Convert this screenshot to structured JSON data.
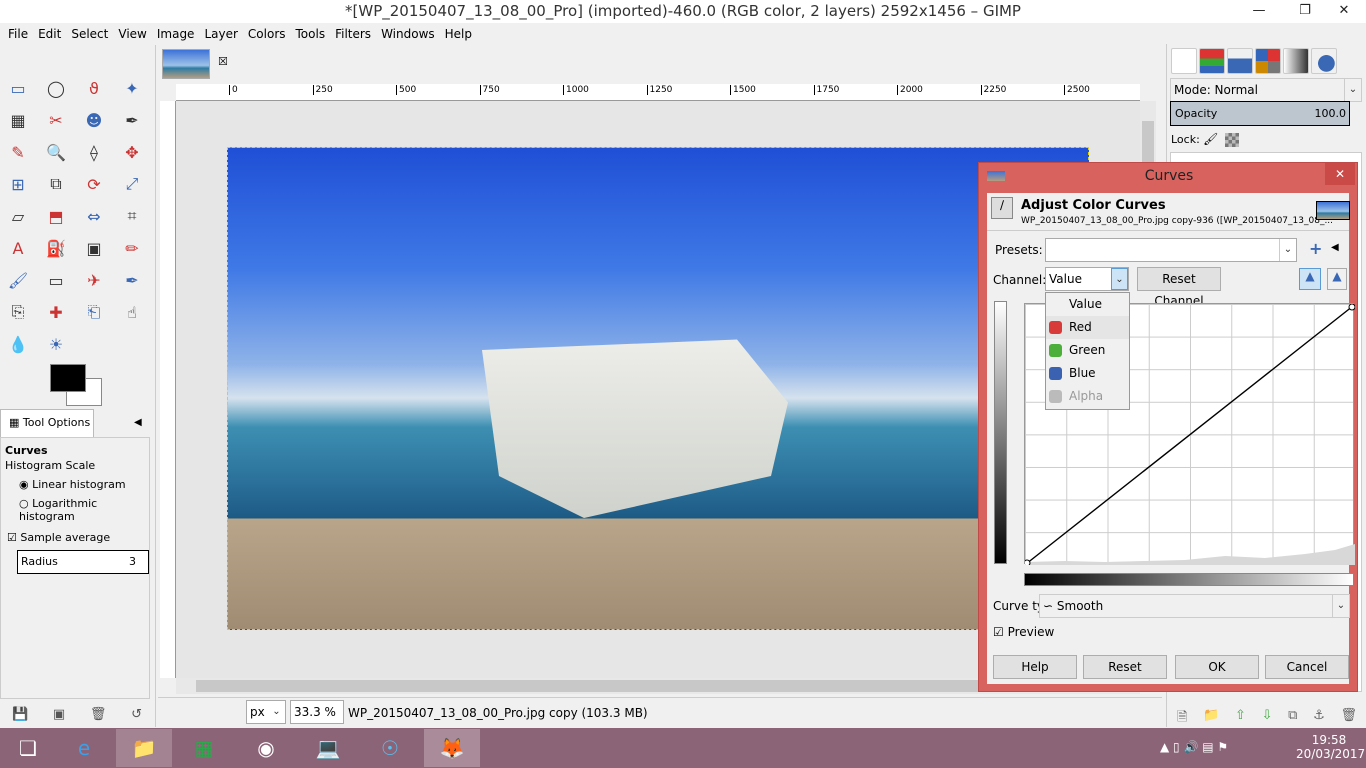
{
  "window": {
    "title": "*[WP_20150407_13_08_00_Pro] (imported)-460.0 (RGB color, 2 layers) 2592x1456 – GIMP"
  },
  "menu": [
    "File",
    "Edit",
    "Select",
    "View",
    "Image",
    "Layer",
    "Colors",
    "Tools",
    "Filters",
    "Windows",
    "Help"
  ],
  "toolbox": {
    "tools": [
      "rect-select",
      "ellipse-select",
      "free-select",
      "fuzzy-select",
      "color-select",
      "scissors",
      "foreground-select",
      "paths",
      "color-picker",
      "zoom",
      "measure",
      "move",
      "align",
      "crop",
      "rotate",
      "scale",
      "shear",
      "perspective",
      "flip",
      "cage",
      "text",
      "bucket-fill",
      "blend",
      "pencil",
      "paintbrush",
      "eraser",
      "airbrush",
      "ink",
      "clone",
      "heal",
      "perspective-clone",
      "smudge",
      "blur",
      "dodge-burn"
    ],
    "fg_color": "#000000",
    "bg_color": "#ffffff",
    "tool_options": {
      "tab": "Tool Options",
      "tool": "Curves",
      "histogram_scale": "Histogram Scale",
      "linear": "Linear histogram",
      "log": "Logarithmic histogram",
      "selected_scale": "linear",
      "sample_average": "Sample average",
      "sample_average_checked": true,
      "radius_label": "Radius",
      "radius_value": "3"
    }
  },
  "ruler": {
    "ticks": [
      "0",
      "250",
      "500",
      "750",
      "1000",
      "1250",
      "1500",
      "1750",
      "2000",
      "2250",
      "2500"
    ]
  },
  "status": {
    "unit": "px",
    "zoom": "33.3 %",
    "info": "WP_20150407_13_08_00_Pro.jpg copy (103.3 MB)"
  },
  "layers": {
    "mode_label": "Mode: Normal",
    "opacity_label": "Opacity",
    "opacity_value": "100.0",
    "lock_label": "Lock:"
  },
  "curves": {
    "title": "Curves",
    "heading": "Adjust Color Curves",
    "subtitle": "WP_20150407_13_08_00_Pro.jpg copy-936 ([WP_20150407_13_08_...",
    "presets_label": "Presets:",
    "presets_value": "",
    "channel_label": "Channel:",
    "channel_value": "Value",
    "reset_channel": "Reset Channel",
    "channel_options": [
      {
        "label": "Value",
        "color": ""
      },
      {
        "label": "Red",
        "color": "#d83a3a"
      },
      {
        "label": "Green",
        "color": "#4caf3a"
      },
      {
        "label": "Blue",
        "color": "#3a62b0"
      },
      {
        "label": "Alpha",
        "color": "#aaaaaa"
      }
    ],
    "curve_type_label": "Curve type:",
    "curve_type_value": "Smooth",
    "preview_label": "Preview",
    "preview_checked": true,
    "buttons": {
      "help": "Help",
      "reset": "Reset",
      "ok": "OK",
      "cancel": "Cancel"
    }
  },
  "taskbar": {
    "time": "19:58",
    "date": "20/03/2017",
    "apps": [
      "explorer",
      "internet-explorer",
      "file-explorer",
      "store",
      "chrome",
      "computer",
      "app",
      "gimp"
    ]
  }
}
